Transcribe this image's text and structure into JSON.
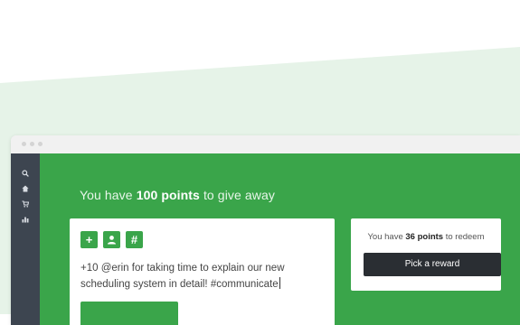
{
  "header": {
    "prefix": "You have",
    "points": "100 points",
    "suffix": "to give away"
  },
  "sidebar": {
    "icons": [
      "search-icon",
      "home-icon",
      "cart-icon",
      "chart-icon"
    ]
  },
  "compose": {
    "tool_plus": "+",
    "tool_user": "▲",
    "tool_hash": "#",
    "message": "+10 @erin for taking time to explain our new scheduling system in detail! #communicate",
    "submit_label": ""
  },
  "redeem": {
    "prefix": "You have",
    "points": "36 points",
    "suffix": "to redeem",
    "button_label": "Pick a reward"
  },
  "colors": {
    "brand_green": "#3aa54a",
    "sidebar": "#3d4550",
    "dark_button": "#2a2e33",
    "background_wedge": "#e6f3e8"
  }
}
